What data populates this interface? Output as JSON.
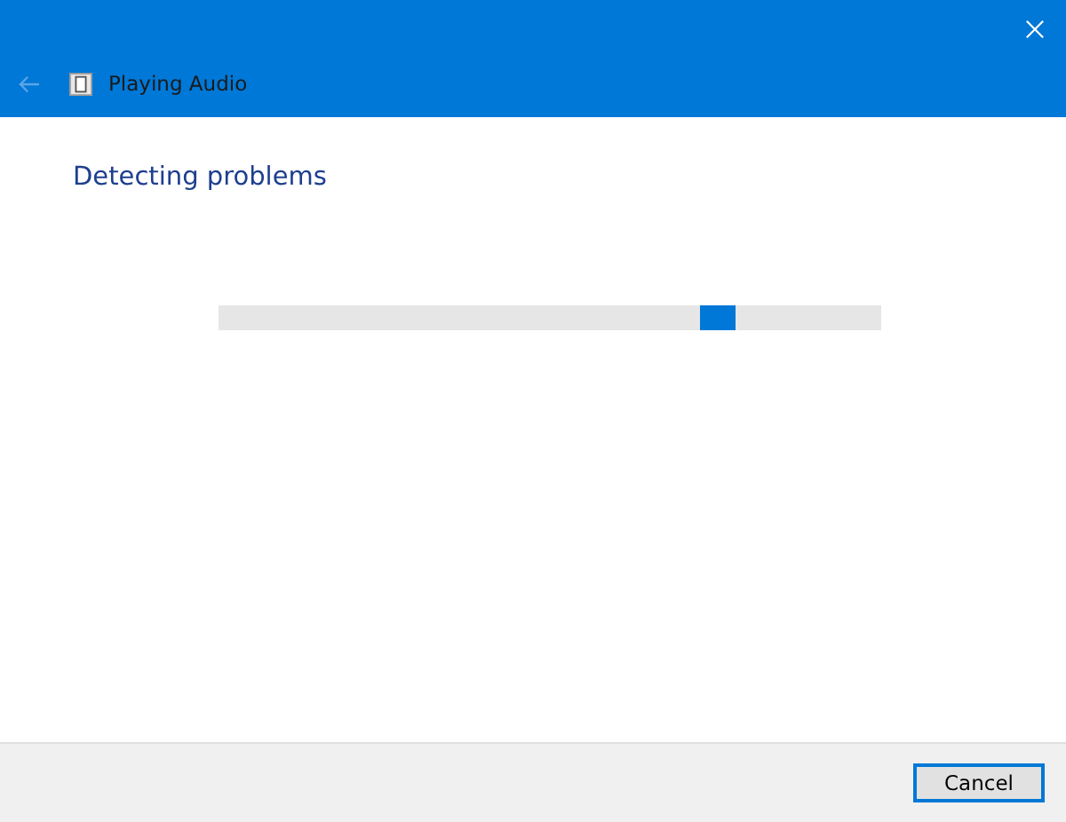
{
  "window": {
    "title": "Playing Audio"
  },
  "back_button": {
    "disabled": true
  },
  "heading": "Detecting problems",
  "progress": {
    "kind": "marquee",
    "level": 0.78
  },
  "buttons": [
    {
      "label": "Cancel",
      "default": true
    }
  ]
}
